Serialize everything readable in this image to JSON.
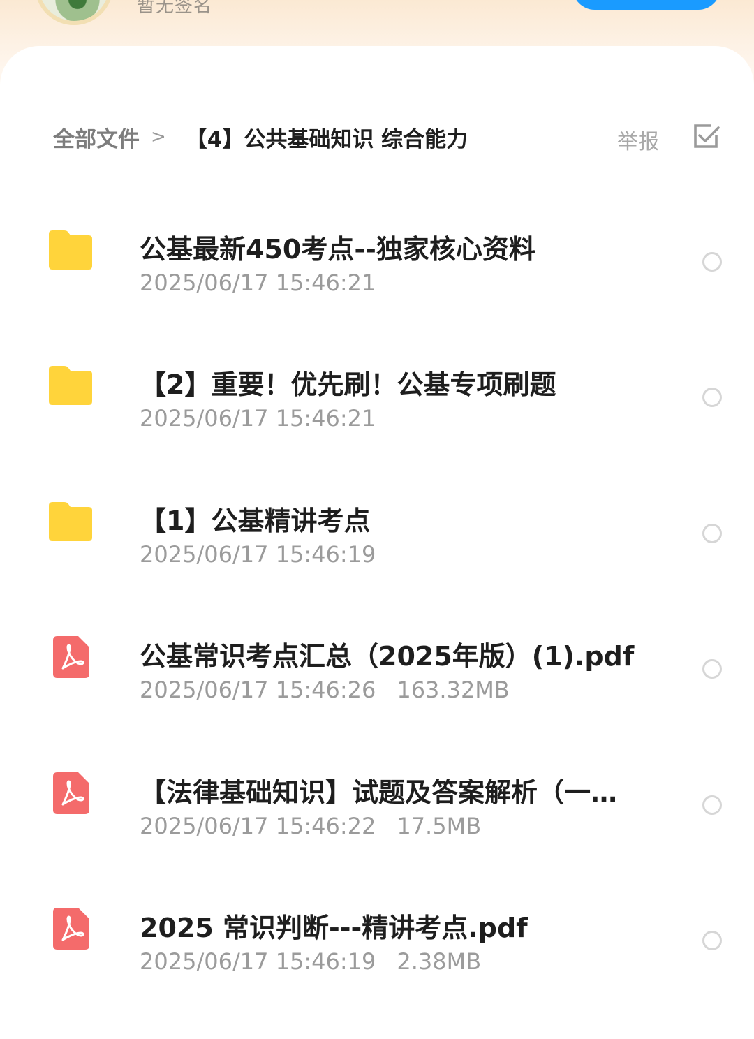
{
  "header": {
    "signature": "暂无签名"
  },
  "breadcrumb": {
    "root": "全部文件",
    "separator": ">",
    "current": "【4】公共基础知识 综合能力"
  },
  "toolbar": {
    "report_label": "举报",
    "select_icon": "checkbox-icon"
  },
  "colors": {
    "folder": "#ffd43b",
    "pdf": "#f46b6b",
    "accent": "#1a9bff"
  },
  "files": [
    {
      "type": "folder",
      "icon": "folder-icon",
      "name": "公基最新450考点--独家核心资料",
      "date": "2025/06/17 15:46:21",
      "size": ""
    },
    {
      "type": "folder",
      "icon": "folder-icon",
      "name": "【2】重要！优先刷！公基专项刷题",
      "date": "2025/06/17 15:46:21",
      "size": ""
    },
    {
      "type": "folder",
      "icon": "folder-icon",
      "name": "【1】公基精讲考点",
      "date": "2025/06/17 15:46:19",
      "size": ""
    },
    {
      "type": "pdf",
      "icon": "pdf-icon",
      "name": "公基常识考点汇总（2025年版）(1).pdf",
      "date": "2025/06/17 15:46:26",
      "size": "163.32MB"
    },
    {
      "type": "pdf",
      "icon": "pdf-icon",
      "name": "【法律基础知识】试题及答案解析（一…",
      "date": "2025/06/17 15:46:22",
      "size": "17.5MB"
    },
    {
      "type": "pdf",
      "icon": "pdf-icon",
      "name": "2025 常识判断---精讲考点.pdf",
      "date": "2025/06/17 15:46:19",
      "size": "2.38MB"
    }
  ]
}
